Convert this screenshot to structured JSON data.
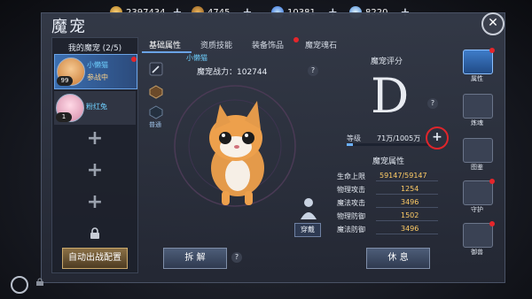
{
  "window": {
    "title": "魔宠",
    "close_label": "✕"
  },
  "currencies": [
    {
      "icon": "gold-coin-icon",
      "value": "2397434",
      "color": "#d9a23b"
    },
    {
      "icon": "feather-coin-icon",
      "value": "4745",
      "color": "#c98c3a"
    },
    {
      "icon": "blue-crystal-icon",
      "value": "10381",
      "color": "#5aa8ff"
    },
    {
      "icon": "diamond-icon",
      "value": "8220",
      "color": "#9ad3ff"
    }
  ],
  "pet_list": {
    "header": "我的魔宠 (2/5)",
    "pets": [
      {
        "name": "小懒猫",
        "status": "参战中",
        "level": "99"
      },
      {
        "name": "粉红兔",
        "status": "",
        "level": "1"
      }
    ],
    "deploy_button": "自动出战配置"
  },
  "tabs": [
    {
      "label": "基础属性",
      "active": true
    },
    {
      "label": "资质技能",
      "active": false
    },
    {
      "label": "装备饰品",
      "active": false
    },
    {
      "label": "魔宠魂石",
      "active": false
    }
  ],
  "center": {
    "pet_name": "小懒猫",
    "combat_power": "魔宠战力：102744",
    "side_icons": [
      "flag-icon",
      "pet-type-icon",
      "normal-badge-icon"
    ],
    "normal_label": "普通",
    "wear_label": "穿戴",
    "release_button": "拆 解",
    "rest_button": "休 息"
  },
  "rating": {
    "label": "魔宠评分",
    "grade": "D",
    "level_label": "等级",
    "level_value": "71万/1005万",
    "xp_fraction": 0.07
  },
  "attributes": {
    "title": "魔宠属性",
    "rows": [
      {
        "name": "生命上限",
        "value": "59147/59147"
      },
      {
        "name": "物理攻击",
        "value": "1254"
      },
      {
        "name": "魔法攻击",
        "value": "3496"
      },
      {
        "name": "物理防御",
        "value": "1502"
      },
      {
        "name": "魔法防御",
        "value": "3496"
      }
    ]
  },
  "sidebar": [
    {
      "label": "属性",
      "icon": "attribute-icon",
      "active": true,
      "dot": true
    },
    {
      "label": "炼魂",
      "icon": "soul-refine-icon",
      "active": false,
      "dot": false
    },
    {
      "label": "图鉴",
      "icon": "codex-icon",
      "active": false,
      "dot": false
    },
    {
      "label": "守护",
      "icon": "guardian-icon",
      "active": false,
      "dot": true
    },
    {
      "label": "御兽",
      "icon": "beast-control-icon",
      "active": false,
      "dot": true
    }
  ],
  "colors": {
    "accent": "#6aa3e6",
    "highlight": "#ffcc66",
    "alert": "#e5262b"
  }
}
